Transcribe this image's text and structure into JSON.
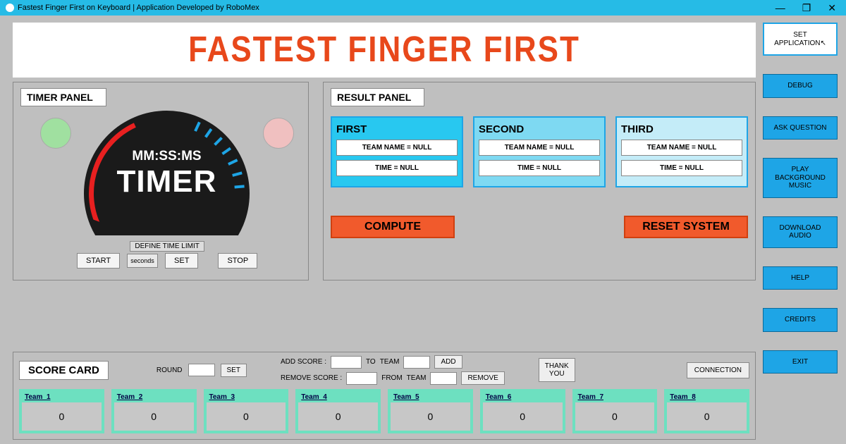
{
  "window": {
    "title": "Fastest Finger First on Keyboard | Application Developed by RoboMex",
    "minimize": "—",
    "maximize": "❐",
    "close": "✕"
  },
  "banner": "FASTEST FINGER FIRST",
  "timer_panel": {
    "title": "TIMER PANEL",
    "label1": "MM:SS:MS",
    "label2": "TIMER",
    "define_limit": "DEFINE TIME LIMIT",
    "start": "START",
    "seconds_placeholder": "seconds",
    "set": "SET",
    "stop": "STOP"
  },
  "result_panel": {
    "title": "RESULT PANEL",
    "cards": [
      {
        "title": "FIRST",
        "team": "TEAM NAME = NULL",
        "time": "TIME  = NULL"
      },
      {
        "title": "SECOND",
        "team": "TEAM NAME = NULL",
        "time": "TIME  = NULL"
      },
      {
        "title": "THIRD",
        "team": "TEAM NAME = NULL",
        "time": "TIME  = NULL"
      }
    ],
    "compute": "COMPUTE",
    "reset": "RESET SYSTEM"
  },
  "scorecard": {
    "title": "SCORE CARD",
    "round_label": "ROUND",
    "set": "SET",
    "add_score_label": "ADD SCORE :",
    "to_label": "TO",
    "team_label": "TEAM",
    "add": "ADD",
    "remove_score_label": "REMOVE SCORE :",
    "from_label": "FROM",
    "remove": "REMOVE",
    "thank_you": "THANK\nYOU",
    "connection": "CONNECTION",
    "teams": [
      {
        "name": "Team_1",
        "score": "0"
      },
      {
        "name": "Team_2",
        "score": "0"
      },
      {
        "name": "Team_3",
        "score": "0"
      },
      {
        "name": "Team_4",
        "score": "0"
      },
      {
        "name": "Team_5",
        "score": "0"
      },
      {
        "name": "Team_6",
        "score": "0"
      },
      {
        "name": "Team_7",
        "score": "0"
      },
      {
        "name": "Team_8",
        "score": "0"
      }
    ]
  },
  "sidebar": {
    "set_app": "SET\nAPPLICATION",
    "debug": "DEBUG",
    "ask": "ASK QUESTION",
    "music": "PLAY\nBACKGROUND\nMUSIC",
    "download": "DOWNLOAD\nAUDIO",
    "help": "HELP",
    "credits": "CREDITS",
    "exit": "EXIT"
  }
}
